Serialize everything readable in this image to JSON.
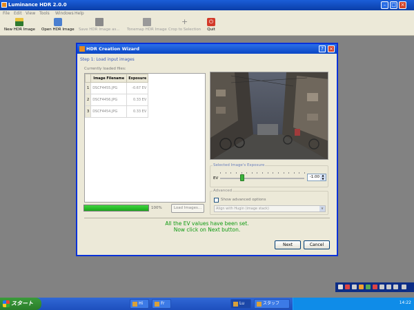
{
  "app": {
    "title": "Luminance HDR 2.0.0",
    "menu": [
      "File",
      "Edit",
      "View",
      "Tools",
      "Windows",
      "Help"
    ],
    "toolbar": [
      {
        "label": "New HDR Image",
        "icon": "new-hdr-icon",
        "enabled": true
      },
      {
        "label": "Open HDR Image",
        "icon": "open-folder-icon",
        "enabled": true
      },
      {
        "label": "Save HDR Image as...",
        "icon": "save-disk-icon",
        "enabled": false
      },
      {
        "label": "Tonemap HDR Image",
        "icon": "tonemap-icon",
        "enabled": false
      },
      {
        "label": "Crop to Selection",
        "icon": "crop-icon",
        "enabled": false
      },
      {
        "label": "Quit",
        "icon": "power-icon",
        "enabled": true
      }
    ]
  },
  "dialog": {
    "title": "HDR Creation Wizard",
    "step_title": "Step 1: Load input images",
    "files_label": "Currently loaded files:",
    "table": {
      "headers": [
        "Image Filename",
        "Exposure"
      ],
      "rows": [
        {
          "index": "1",
          "filename": "DSCF4455.JPG",
          "exposure": "-0.67 EV"
        },
        {
          "index": "2",
          "filename": "DSCF4456.JPG",
          "exposure": "0.33 EV"
        },
        {
          "index": "3",
          "filename": "DSCF4454.JPG",
          "exposure": "0.33 EV"
        }
      ]
    },
    "progress": {
      "value": 100,
      "text": "100%"
    },
    "load_button": "Load Images...",
    "ev_group": {
      "title": "Selected Image's Exposure",
      "prefix": "EV",
      "value": "-1.00",
      "slider_fraction": 0.26
    },
    "advanced": {
      "title": "Advanced",
      "checkbox_label": "Show advanced options",
      "checked": false,
      "select_value": "Align with Hugin (image stack)"
    },
    "message_line1": "All the EV values have been set.",
    "message_line2": "Now click on Next button.",
    "next_button": "Next",
    "cancel_button": "Cancel"
  },
  "taskbar": {
    "start_label": "スタート",
    "tasks": [
      "Hi",
      "Fr",
      "Lu",
      "スタッフ"
    ],
    "clock": "14:22"
  }
}
